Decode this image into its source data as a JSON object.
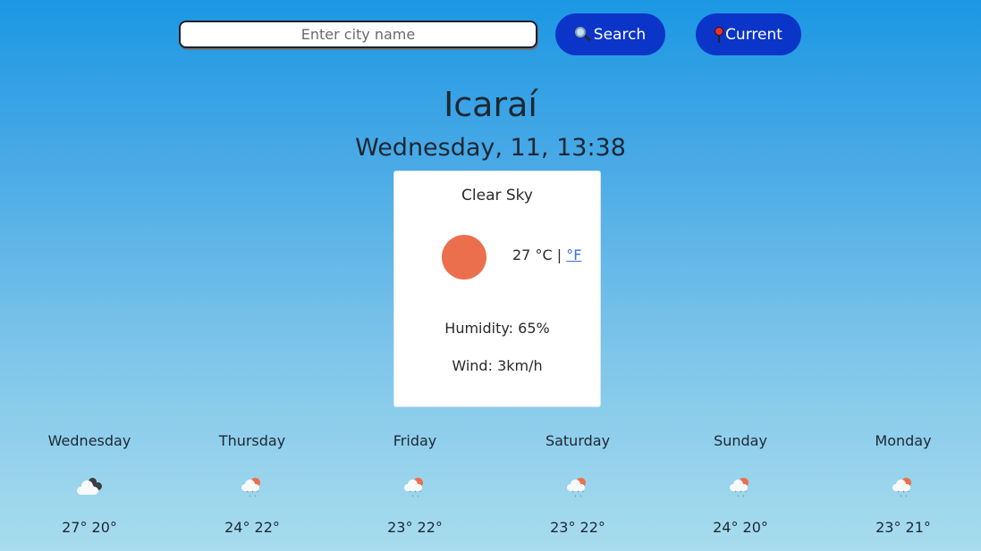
{
  "search": {
    "placeholder": "Enter city name",
    "value": "",
    "search_label": "Search",
    "search_icon": "magnifying-glass-icon",
    "current_label": "Current",
    "current_icon": "round-pushpin-icon"
  },
  "location": {
    "city": "Icaraí",
    "datetime": "Wednesday, 11, 13:38"
  },
  "current": {
    "description": "Clear Sky",
    "icon": "sun-icon",
    "temperature": "27",
    "unit_celsius": "°C",
    "separator": "|",
    "unit_fahrenheit_link": "°F",
    "humidity": "Humidity: 65%",
    "wind": "Wind: 3km/h"
  },
  "colors": {
    "button_bg": "#0b35c8",
    "sun": "#ec6f4d",
    "link": "#3c6fd8",
    "bg_top": "#1b97e3",
    "bg_bottom": "#a8dcee"
  },
  "forecast": [
    {
      "day": "Wednesday",
      "icon": "cloudy-dark-cloud-icon",
      "temps": "27° 20°"
    },
    {
      "day": "Thursday",
      "icon": "rain-sun-cloud-icon",
      "temps": "24° 22°"
    },
    {
      "day": "Friday",
      "icon": "rain-sun-cloud-icon",
      "temps": "23° 22°"
    },
    {
      "day": "Saturday",
      "icon": "rain-sun-cloud-icon",
      "temps": "23° 22°"
    },
    {
      "day": "Sunday",
      "icon": "rain-sun-cloud-icon",
      "temps": "24° 20°"
    },
    {
      "day": "Monday",
      "icon": "rain-sun-cloud-icon",
      "temps": "23° 21°"
    }
  ]
}
